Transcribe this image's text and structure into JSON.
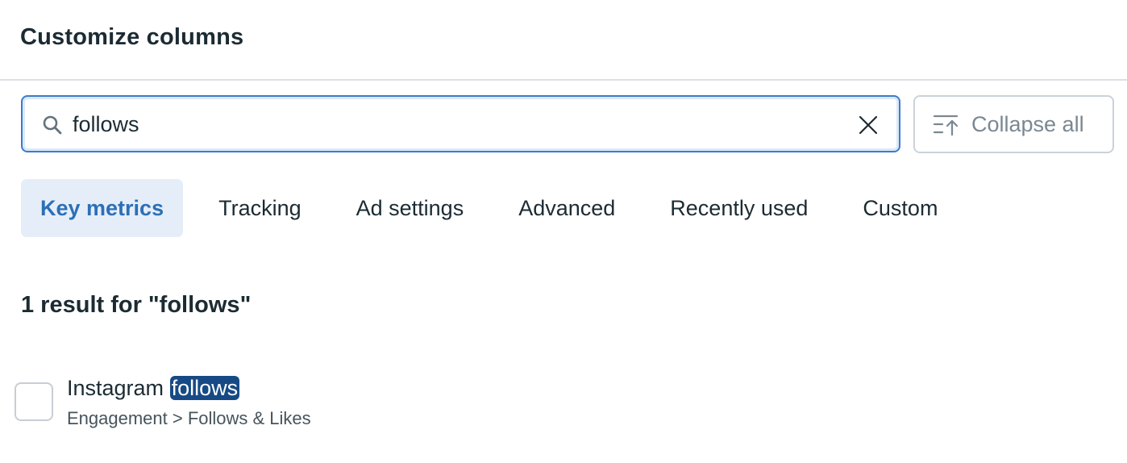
{
  "dialog": {
    "title": "Customize columns"
  },
  "search": {
    "value": "follows",
    "icon": "search-icon",
    "clear_icon": "close-icon"
  },
  "collapse_button": {
    "label": "Collapse all",
    "icon": "collapse-all-icon"
  },
  "tabs": [
    {
      "label": "Key metrics",
      "active": true
    },
    {
      "label": "Tracking",
      "active": false
    },
    {
      "label": "Ad settings",
      "active": false
    },
    {
      "label": "Advanced",
      "active": false
    },
    {
      "label": "Recently used",
      "active": false
    },
    {
      "label": "Custom",
      "active": false
    }
  ],
  "results": {
    "summary": "1 result for \"follows\"",
    "items": [
      {
        "name_prefix": "Instagram ",
        "name_match": "follows",
        "path": "Engagement > Follows & Likes",
        "checked": false
      }
    ]
  },
  "colors": {
    "accent": "#2d6fb7",
    "active_tab_bg": "#e5eef8",
    "highlight_bg": "#174a85",
    "focus_border": "#3b7bcf"
  }
}
